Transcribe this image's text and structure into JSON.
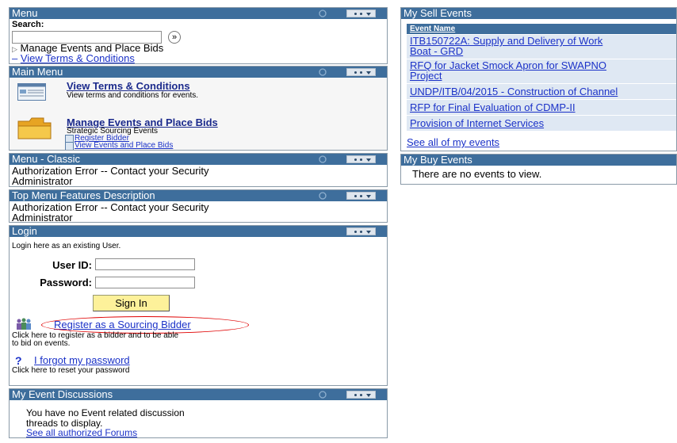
{
  "menu": {
    "title": "Menu",
    "search_label": "Search:",
    "search_value": "",
    "search_go": "»",
    "manage": "Manage Events and Place Bids",
    "view_terms": "View Terms & Conditions"
  },
  "main_menu": {
    "title": "Main Menu",
    "terms_title": "View Terms & Conditions",
    "terms_desc": "View terms and conditions for events.",
    "manage_title": "Manage Events and Place Bids",
    "manage_desc": "Strategic Sourcing Events",
    "register": "Register Bidder",
    "view_events": "View Events and Place Bids"
  },
  "menu_classic": {
    "title": "Menu - Classic",
    "err1": "Authorization Error -- Contact your Security",
    "err2": "Administrator"
  },
  "top_menu": {
    "title": "Top Menu Features Description",
    "err1": "Authorization Error -- Contact your Security",
    "err2": "Administrator"
  },
  "login": {
    "title": "Login",
    "intro": "Login here as an existing User.",
    "userid_label": "User ID:",
    "userid_value": "",
    "password_label": "Password:",
    "password_value": "",
    "signin": "Sign In",
    "register_link": "Register as a Sourcing Bidder",
    "register_desc1": "Click here to register as a bidder and to be able",
    "register_desc2": "to bid on events.",
    "help_mark": "?",
    "forgot": "I forgot my password",
    "forgot_desc": "Click here to reset your password"
  },
  "discussions": {
    "title": "My Event Discussions",
    "line1": "You have no Event related discussion",
    "line2": "threads to display.",
    "forums": "See all authorized Forums"
  },
  "sell": {
    "title": "My Sell Events",
    "col": "Event Name",
    "rows": [
      {
        "l1": "ITB150722A: Supply and Delivery of Work",
        "l2": "Boat - GRD"
      },
      {
        "l1": "RFQ for Jacket Smock Apron for SWAPNO",
        "l2": "Project"
      },
      {
        "l1": "UNDP/ITB/04/2015 - Construction of Channel",
        "l2": ""
      },
      {
        "l1": "RFP for Final Evaluation of CDMP-II",
        "l2": ""
      },
      {
        "l1": "Provision of Internet Services",
        "l2": ""
      }
    ],
    "see_all": "See all of my events"
  },
  "buy": {
    "title": "My Buy Events",
    "empty": "There are no events to view."
  },
  "colors": {
    "header": "#3e6e9c",
    "link": "#1b32c8",
    "highlight": "#e00000"
  }
}
